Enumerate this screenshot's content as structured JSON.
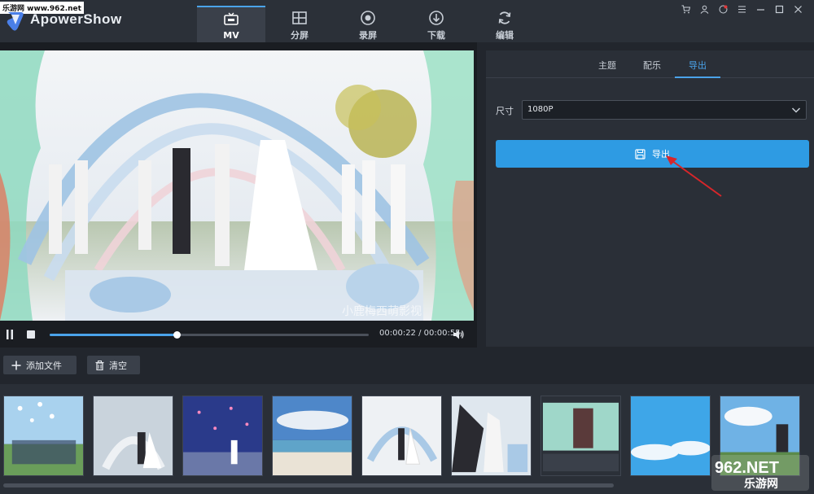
{
  "app": {
    "name": "ApowerShow",
    "site_watermark": "乐游网 www.962.net"
  },
  "nav": {
    "tabs": [
      {
        "label": "MV",
        "icon": "tv-icon",
        "active": true
      },
      {
        "label": "分屏",
        "icon": "split-screen-icon",
        "active": false
      },
      {
        "label": "录屏",
        "icon": "record-icon",
        "active": false
      },
      {
        "label": "下载",
        "icon": "download-icon",
        "active": false
      },
      {
        "label": "编辑",
        "icon": "refresh-edit-icon",
        "active": false
      }
    ]
  },
  "window_controls": [
    "cart-icon",
    "user-icon",
    "support-icon",
    "menu-icon",
    "minimize-icon",
    "maximize-icon",
    "close-icon"
  ],
  "player": {
    "current_time": "00:00:22",
    "duration": "00:00:55",
    "time_display": "00:00:22 / 00:00:55",
    "progress_fraction": 0.4,
    "video_watermark": "小鹿梅西萌影视"
  },
  "panel": {
    "tabs": [
      {
        "label": "主题",
        "active": false
      },
      {
        "label": "配乐",
        "active": false
      },
      {
        "label": "导出",
        "active": true
      }
    ],
    "size_label": "尺寸",
    "size_value": "1080P",
    "export_label": "导出"
  },
  "toolbar": {
    "add_file_label": "添加文件",
    "clear_label": "清空"
  },
  "thumbnails": [
    {
      "name": "thumb-balloons"
    },
    {
      "name": "thumb-arch-ceremony"
    },
    {
      "name": "thumb-night-petals"
    },
    {
      "name": "thumb-beach-sky"
    },
    {
      "name": "thumb-flower-arch"
    },
    {
      "name": "thumb-bouquet-toss"
    },
    {
      "name": "thumb-app-screenshot"
    },
    {
      "name": "thumb-blue-clouds"
    },
    {
      "name": "thumb-sky-couple"
    }
  ],
  "corner_watermark": {
    "line1": "962.NET",
    "line2": "乐游网"
  },
  "colors": {
    "accent": "#2e9be3",
    "annotation": "#d8262a"
  }
}
